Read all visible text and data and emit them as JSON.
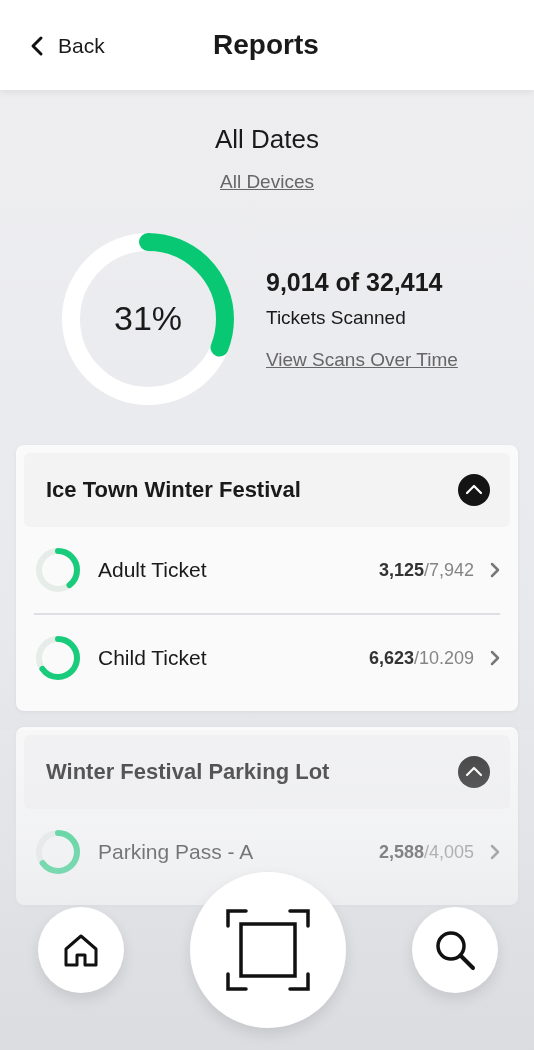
{
  "header": {
    "back": "Back",
    "title": "Reports"
  },
  "summary": {
    "date": "All Dates",
    "devices": "All Devices",
    "percent": "31%",
    "count": "9,014 of 32,414",
    "caption": "Tickets Scanned",
    "link": "View Scans Over Time"
  },
  "events": [
    {
      "name": "Ice Town Winter Festival",
      "expanded": true,
      "items": [
        {
          "name": "Adult Ticket",
          "scanned": "3,125",
          "total": "/7,942"
        },
        {
          "name": "Child Ticket",
          "scanned": "6,623",
          "total": "/10.209"
        }
      ]
    },
    {
      "name": "Winter Festival Parking Lot",
      "expanded": true,
      "items": [
        {
          "name": "Parking Pass - A",
          "scanned": "2,588",
          "total": "/4,005"
        }
      ]
    }
  ]
}
